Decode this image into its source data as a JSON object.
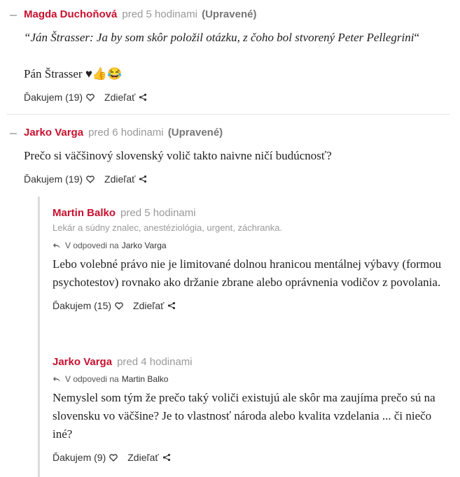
{
  "comments": [
    {
      "author": "Magda Duchoňová",
      "time": "pred 5 hodinami",
      "edited": "(Upravené)",
      "quote_author": "Ján Štrasser",
      "quote_text": ": Ja by som skôr položil otázku, z čoho bol stvorený Peter Pellegrini",
      "quote_open": "“",
      "quote_close": "“",
      "text2": "Pán Štrasser ♥👍😂",
      "thanks": "Ďakujem (19)",
      "share": "Zdieľať"
    },
    {
      "author": "Jarko Varga",
      "time": "pred 6 hodinami",
      "edited": "(Upravené)",
      "text": "Prečo si väčšinový slovenský volič takto naivne ničí budúcnosť?",
      "thanks": "Ďakujem (19)",
      "share": "Zdieľať"
    },
    {
      "author": "Martin Balko",
      "time": "pred 5 hodinami",
      "bio": "Lekár a súdny znalec, anestéziológia, urgent, záchranka.",
      "reply_prefix": "V odpovedi na",
      "reply_to": "Jarko Varga",
      "text": "Lebo volebné právo nie je limitované dolnou hranicou mentálnej výbavy (formou psychotestov) rovnako ako držanie zbrane alebo oprávnenia vodičov z povolania.",
      "thanks": "Ďakujem (15)",
      "share": "Zdieľať"
    },
    {
      "author": "Jarko Varga",
      "time": "pred 4 hodinami",
      "reply_prefix": "V odpovedi na",
      "reply_to": "Martin Balko",
      "text": "Nemyslel som tým že prečo taký voliči existujú ale skôr ma zaujíma prečo sú na slovensku vo väčšine? Je to vlastnosť národa alebo kvalita vzdelania ... či niečo iné?",
      "thanks": "Ďakujem (9)",
      "share": "Zdieľať"
    }
  ],
  "icons": {
    "heart": "heart-icon",
    "share": "share-icon",
    "reply": "reply-arrow-icon",
    "collapse": "collapse-icon"
  },
  "colors": {
    "author": "#c8102e",
    "muted": "#999999",
    "divider": "#e6e6e6"
  }
}
